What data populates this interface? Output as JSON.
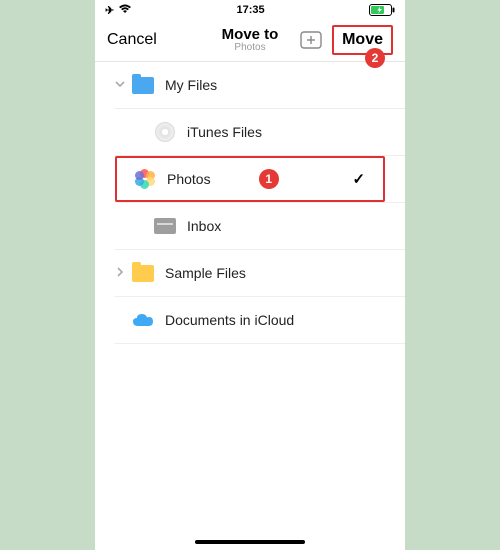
{
  "status": {
    "time": "17:35"
  },
  "nav": {
    "cancel": "Cancel",
    "title": "Move to",
    "subtitle": "Photos",
    "move": "Move"
  },
  "folders": {
    "root": "My Files",
    "itunes": "iTunes Files",
    "photos": "Photos",
    "inbox": "Inbox",
    "sample": "Sample Files",
    "icloud": "Documents in iCloud"
  },
  "callouts": {
    "one": "1",
    "two": "2"
  }
}
